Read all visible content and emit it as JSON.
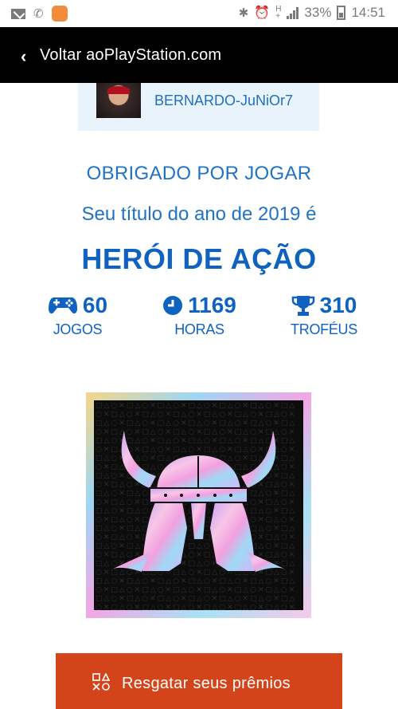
{
  "status_bar": {
    "battery": "33%",
    "time": "14:51"
  },
  "top_bar": {
    "back_label": "Voltar aoPlayStation.com"
  },
  "user": {
    "username": "BERNARDO-JuNiOr7"
  },
  "summary": {
    "thanks": "OBRIGADO POR JOGAR",
    "subtitle": "Seu título do ano de 2019 é",
    "title": "HERÓI DE AÇÃO"
  },
  "stats": {
    "games": {
      "value": "60",
      "label": "JOGOS",
      "icon": "gamepad-icon"
    },
    "hours": {
      "value": "1169",
      "label": "HORAS",
      "icon": "clock-icon"
    },
    "trophies": {
      "value": "310",
      "label": "TROFÉUS",
      "icon": "trophy-icon"
    }
  },
  "badge": {
    "icon": "viking-helmet-icon",
    "pattern_icon": "playstation-shapes-pattern"
  },
  "redeem_button": {
    "label": "Resgatar seus prêmios",
    "icon": "playstation-shapes-icon"
  },
  "colors": {
    "accent_blue": "#0f62c0",
    "button_orange": "#d4441a",
    "card_bg": "#e8f3fb"
  }
}
